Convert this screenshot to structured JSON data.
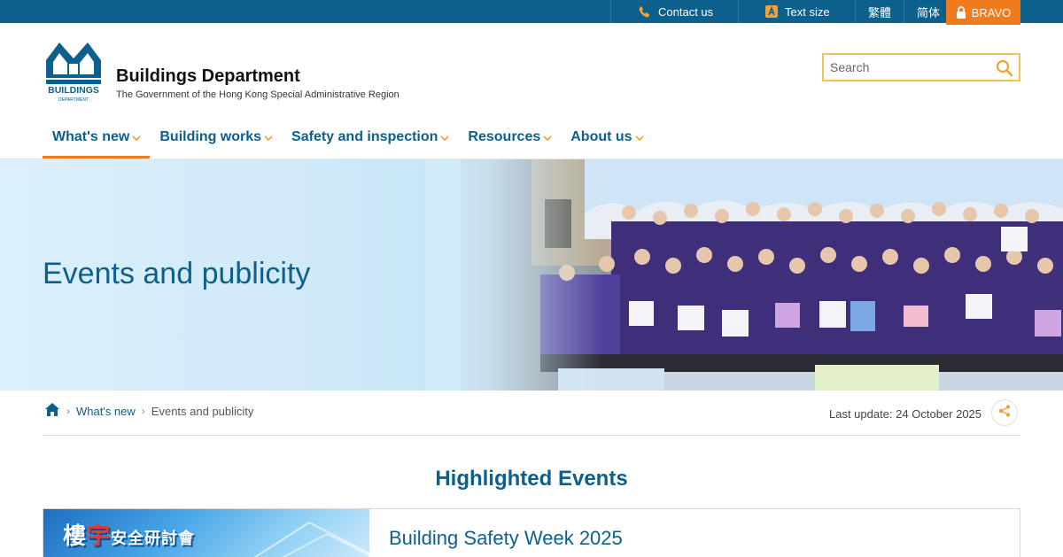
{
  "topbar": {
    "contact_label": "Contact us",
    "text_size_label": "Text size",
    "lang_traditional": "繁體",
    "lang_simplified": "简体",
    "bravo_label": "BRAVO"
  },
  "header": {
    "logo_text": "BUILDINGS",
    "logo_subtext": "DEPARTMENT",
    "department_name": "Buildings Department",
    "department_subtitle": "The Government of the Hong Kong Special Administrative Region"
  },
  "search": {
    "placeholder": "Search"
  },
  "nav": {
    "items": [
      {
        "label": "What's new"
      },
      {
        "label": "Building works"
      },
      {
        "label": "Safety and inspection"
      },
      {
        "label": "Resources"
      },
      {
        "label": "About us"
      }
    ]
  },
  "banner": {
    "title": "Events and publicity"
  },
  "breadcrumb": {
    "level1": "What's new",
    "level2": "Events and publicity"
  },
  "last_update": "Last update: 24 October 2025",
  "highlighted": {
    "section_title": "Highlighted Events",
    "event_image_text_a": "樓",
    "event_image_text_b": "宇",
    "event_image_text_c": "安全研討會",
    "event_title": "Building Safety Week 2025"
  },
  "colors": {
    "primary": "#0d5f8c",
    "accent": "#f07b1d",
    "search_border": "#f2c25a"
  }
}
